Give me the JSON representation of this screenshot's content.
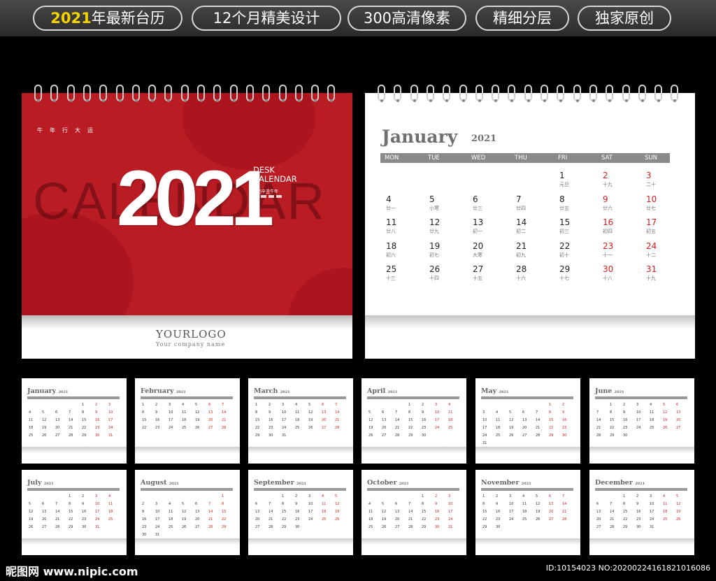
{
  "banner": {
    "tags": [
      {
        "highlight": "2021",
        "text": "年最新台历"
      },
      {
        "highlight": "",
        "text": "12个月精美设计"
      },
      {
        "highlight": "",
        "text": "300高清像素"
      },
      {
        "highlight": "",
        "text": "精细分层"
      },
      {
        "highlight": "",
        "text": "独家原创"
      }
    ]
  },
  "cover": {
    "slogan": "牛年行大运",
    "year": "2021",
    "watermark": "CALENDAR",
    "desk": "DESK",
    "calendar": "CALENDAR",
    "lunar": "农历辛丑牛年",
    "logo": "YOURLOGO",
    "company": "Your company name",
    "color": "#b91c22"
  },
  "january": {
    "month": "January",
    "year": "2021",
    "weekdays": [
      "MON",
      "TUE",
      "WED",
      "THU",
      "FRI",
      "SAT",
      "SUN"
    ],
    "weeks": [
      [
        null,
        null,
        null,
        null,
        {
          "d": "1",
          "l": "元旦"
        },
        {
          "d": "2",
          "l": "十九"
        },
        {
          "d": "3",
          "l": "二十"
        }
      ],
      [
        {
          "d": "4",
          "l": "廿一"
        },
        {
          "d": "5",
          "l": "小寒"
        },
        {
          "d": "6",
          "l": "廿三"
        },
        {
          "d": "7",
          "l": "廿四"
        },
        {
          "d": "8",
          "l": "廿五"
        },
        {
          "d": "9",
          "l": "廿六"
        },
        {
          "d": "10",
          "l": "廿七"
        }
      ],
      [
        {
          "d": "11",
          "l": "廿八"
        },
        {
          "d": "12",
          "l": "廿九"
        },
        {
          "d": "13",
          "l": "初一"
        },
        {
          "d": "14",
          "l": "初二"
        },
        {
          "d": "15",
          "l": "初三"
        },
        {
          "d": "16",
          "l": "初四"
        },
        {
          "d": "17",
          "l": "初五"
        }
      ],
      [
        {
          "d": "18",
          "l": "初六"
        },
        {
          "d": "19",
          "l": "初七"
        },
        {
          "d": "20",
          "l": "大寒"
        },
        {
          "d": "21",
          "l": "初九"
        },
        {
          "d": "22",
          "l": "初十"
        },
        {
          "d": "23",
          "l": "十一"
        },
        {
          "d": "24",
          "l": "十二"
        }
      ],
      [
        {
          "d": "25",
          "l": "十三"
        },
        {
          "d": "26",
          "l": "十四"
        },
        {
          "d": "27",
          "l": "十五"
        },
        {
          "d": "28",
          "l": "十六"
        },
        {
          "d": "29",
          "l": "十七"
        },
        {
          "d": "30",
          "l": "十八"
        },
        {
          "d": "31",
          "l": "十九"
        }
      ]
    ],
    "weekend_color": "#d22020"
  },
  "thumbnails": [
    {
      "month": "January",
      "year": "2021"
    },
    {
      "month": "February",
      "year": "2021"
    },
    {
      "month": "March",
      "year": "2021"
    },
    {
      "month": "April",
      "year": "2021"
    },
    {
      "month": "May",
      "year": "2021"
    },
    {
      "month": "June",
      "year": "2021"
    },
    {
      "month": "July",
      "year": "2021"
    },
    {
      "month": "August",
      "year": "2021"
    },
    {
      "month": "September",
      "year": "2021"
    },
    {
      "month": "October",
      "year": "2021"
    },
    {
      "month": "November",
      "year": "2021"
    },
    {
      "month": "December",
      "year": "2021"
    }
  ],
  "footer": {
    "logo": "昵图网 www.nipic.com",
    "id": "ID:10154023 NO:20200224161821016086"
  }
}
